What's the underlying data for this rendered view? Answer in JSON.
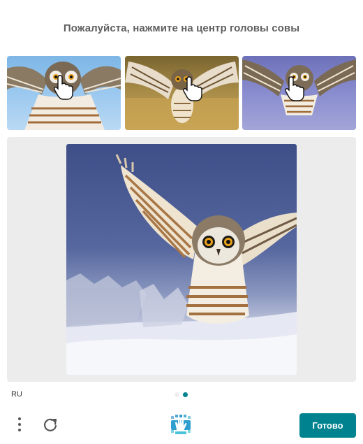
{
  "prompt": "Пожалуйста, нажмите на центр головы совы",
  "examples": [
    {
      "subject": "owl",
      "icon": "hand-pointer-icon"
    },
    {
      "subject": "owl",
      "icon": "hand-pointer-icon"
    },
    {
      "subject": "owl",
      "icon": "hand-pointer-icon"
    }
  ],
  "task_image": {
    "subject": "owl"
  },
  "footer": {
    "language": "RU",
    "page_dots": {
      "count": 2,
      "active_index": 1
    },
    "menu_icon": "vertical-dots-icon",
    "refresh_icon": "refresh-icon",
    "logo_icon": "hcaptcha-logo-icon",
    "submit_label": "Готово"
  },
  "colors": {
    "accent": "#00838f",
    "prompt_text": "#5f5f5f",
    "task_background": "#ececec"
  }
}
